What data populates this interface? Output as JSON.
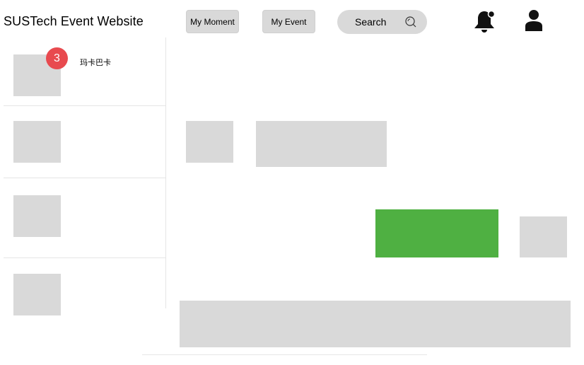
{
  "header": {
    "site_title": "SUSTech Event Website",
    "nav": {
      "my_moment": "My Moment",
      "my_event": "My Event"
    },
    "search": {
      "label": "Search",
      "icon": "search-icon"
    },
    "notification": {
      "icon": "bell-icon",
      "has_dot": true
    },
    "profile": {
      "icon": "user-icon"
    }
  },
  "sidebar": {
    "conversations": [
      {
        "name": "玛卡巴卡",
        "unread": "3"
      },
      {
        "name": "",
        "unread": ""
      },
      {
        "name": "",
        "unread": ""
      },
      {
        "name": "",
        "unread": ""
      }
    ]
  },
  "colors": {
    "placeholder": "#d9d9d9",
    "accent_green": "#4fb042",
    "badge_red": "#e84a4f"
  }
}
